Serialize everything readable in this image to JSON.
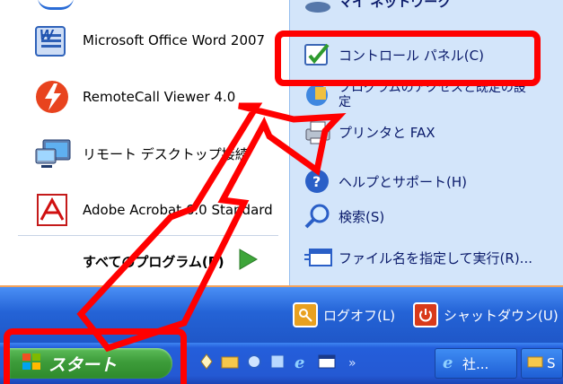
{
  "left_items": [
    {
      "label": "Microsoft Office Word 2007",
      "icon": "word-icon"
    },
    {
      "label": "RemoteCall Viewer 4.0",
      "icon": "remotecall-icon"
    },
    {
      "label": "リモート デスクトップ接続",
      "icon": "remote-desktop-icon"
    },
    {
      "label": "Adobe Acrobat 6.0 Standard",
      "icon": "acrobat-icon"
    }
  ],
  "all_programs_label": "すべてのプログラム(P)",
  "right_items": [
    {
      "label": "マイ ネットワーク",
      "icon": "network-icon"
    },
    {
      "label": "コントロール パネル(C)",
      "icon": "control-panel-icon"
    },
    {
      "label": "プログラムのアクセスと既定の設定",
      "icon": "program-access-icon"
    },
    {
      "label": "プリンタと FAX",
      "icon": "printer-icon"
    },
    {
      "label": "ヘルプとサポート(H)",
      "icon": "help-icon"
    },
    {
      "label": "検索(S)",
      "icon": "search-icon"
    },
    {
      "label": "ファイル名を指定して実行(R)...",
      "icon": "run-icon"
    }
  ],
  "footer": {
    "logoff_label": "ログオフ(L)",
    "shutdown_label": "シャットダウン(U)"
  },
  "taskbar": {
    "start_label": "スタート",
    "window_buttons": [
      {
        "label": "社...",
        "icon": "ie-icon"
      },
      {
        "label": "S",
        "icon": "folder-icon"
      }
    ]
  },
  "colors": {
    "highlight_red": "#ff0000",
    "taskbar_blue": "#245edb",
    "start_green": "#3d9c3a"
  }
}
